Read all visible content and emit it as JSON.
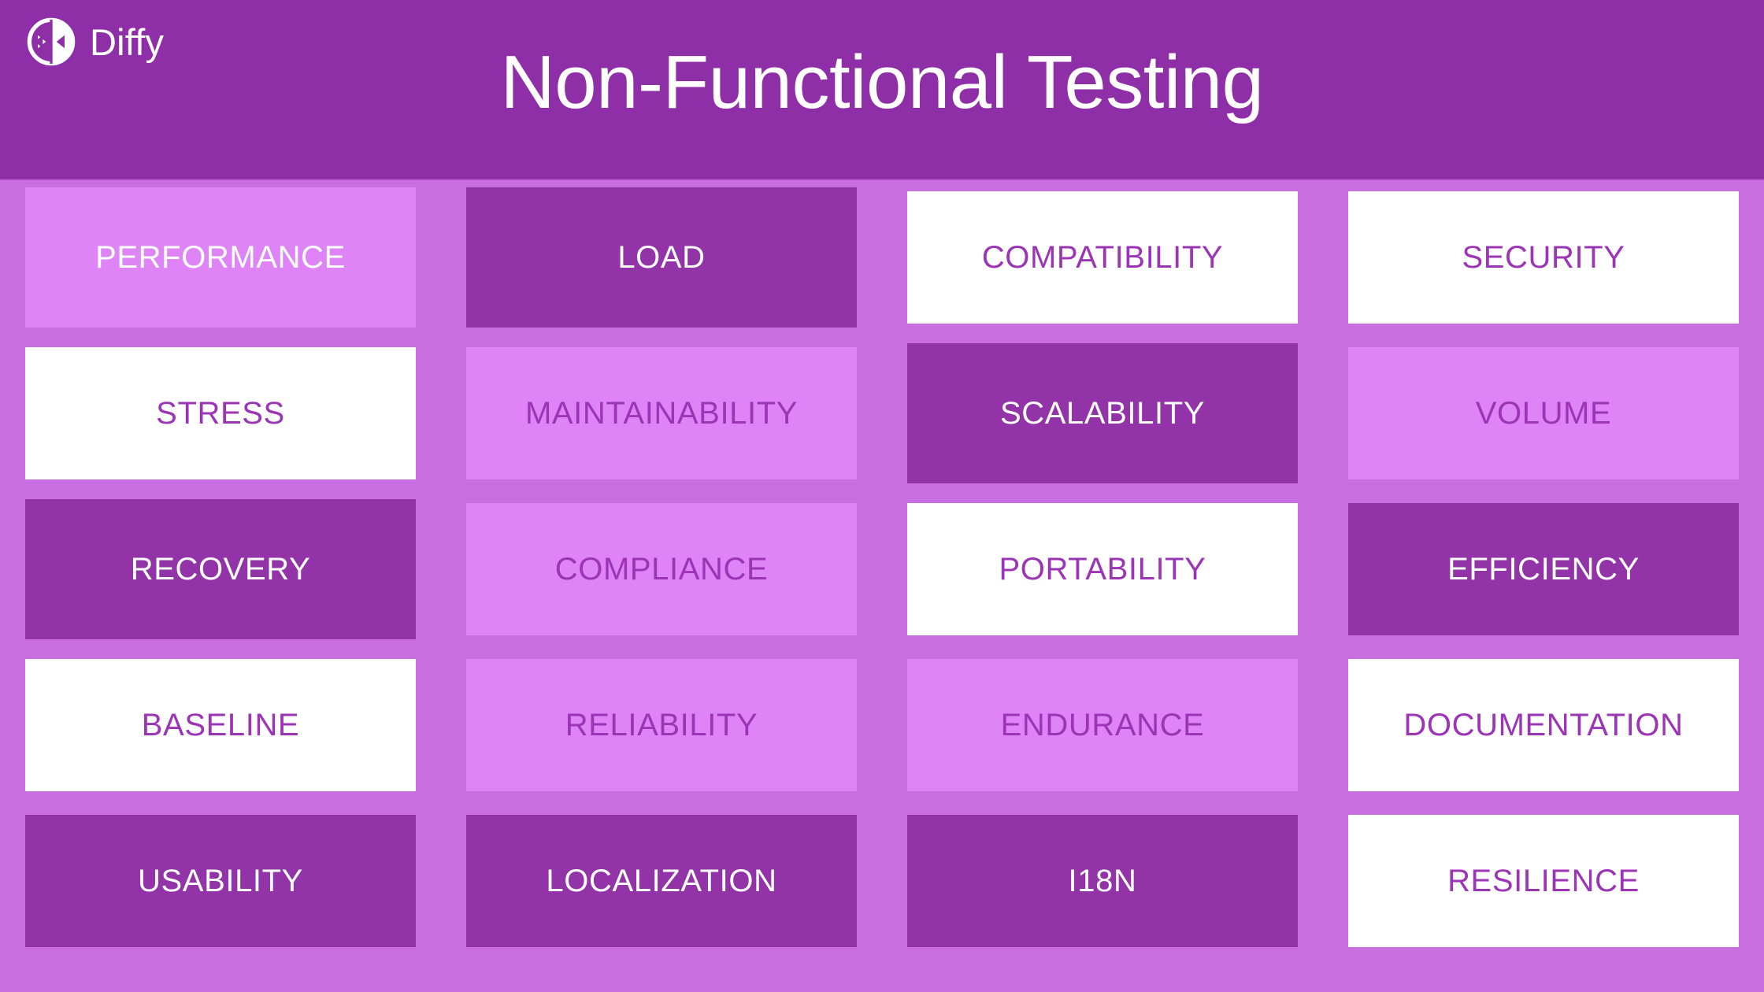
{
  "header": {
    "brand_name": "Diffy",
    "logo_icon": "diff-compare-circle-icon",
    "title": "Non-Functional Testing",
    "background_color": "#8f2fa8",
    "text_color": "#ffffff"
  },
  "theme": {
    "page_background": "#c86ee0",
    "dark_cell": "#9333a8",
    "light_cell": "#de84f7",
    "white_cell": "#ffffff",
    "purple_text": "#9b35b6",
    "white_text": "#ffffff"
  },
  "grid": {
    "columns": 4,
    "rows": 5,
    "cells": [
      {
        "label": "PERFORMANCE",
        "tone": "light-on-white",
        "size": "tall"
      },
      {
        "label": "LOAD",
        "tone": "dark",
        "size": "tall"
      },
      {
        "label": "COMPATIBILITY",
        "tone": "white",
        "size": "mid"
      },
      {
        "label": "SECURITY",
        "tone": "white",
        "size": "mid"
      },
      {
        "label": "STRESS",
        "tone": "white",
        "size": "mid"
      },
      {
        "label": "MAINTAINABILITY",
        "tone": "light",
        "size": "mid"
      },
      {
        "label": "SCALABILITY",
        "tone": "dark",
        "size": "tall"
      },
      {
        "label": "VOLUME",
        "tone": "light",
        "size": "mid"
      },
      {
        "label": "RECOVERY",
        "tone": "dark",
        "size": "tall"
      },
      {
        "label": "COMPLIANCE",
        "tone": "light",
        "size": "mid"
      },
      {
        "label": "PORTABILITY",
        "tone": "white",
        "size": "mid"
      },
      {
        "label": "EFFICIENCY",
        "tone": "dark",
        "size": "mid"
      },
      {
        "label": "BASELINE",
        "tone": "white",
        "size": "mid"
      },
      {
        "label": "RELIABILITY",
        "tone": "light",
        "size": "mid"
      },
      {
        "label": "ENDURANCE",
        "tone": "light",
        "size": "mid"
      },
      {
        "label": "DOCUMENTATION",
        "tone": "white",
        "size": "mid"
      },
      {
        "label": "USABILITY",
        "tone": "dark",
        "size": "mid"
      },
      {
        "label": "LOCALIZATION",
        "tone": "dark",
        "size": "mid"
      },
      {
        "label": "I18N",
        "tone": "dark",
        "size": "mid"
      },
      {
        "label": "RESILIENCE",
        "tone": "white",
        "size": "mid"
      }
    ]
  }
}
